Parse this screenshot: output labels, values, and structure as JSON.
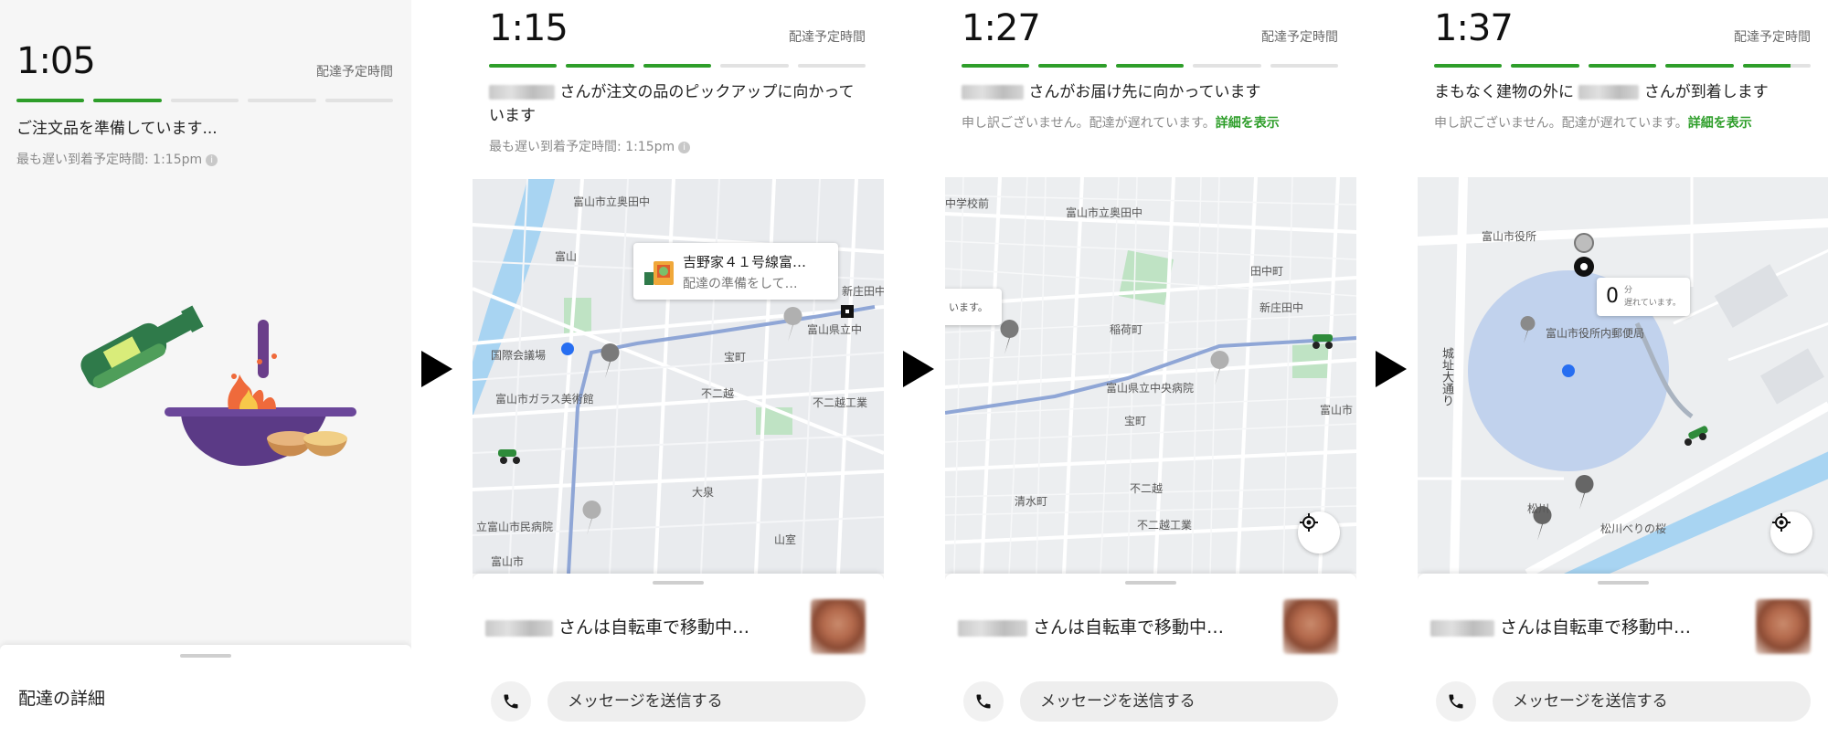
{
  "eta_label": "配達予定時間",
  "panels": [
    {
      "time": "1:05",
      "progress_filled": 2,
      "progress_total": 5,
      "status": "ご注文品を準備しています...",
      "sub": "最も遅い到着予定時間: 1:15pm",
      "sheet_title": "配達の詳細"
    },
    {
      "time": "1:15",
      "progress_filled": 3,
      "progress_total": 5,
      "status": "さんが注文の品のピックアップに向かっています",
      "sub": "最も遅い到着予定時間: 1:15pm",
      "restaurant_name": "吉野家４１号線富…",
      "restaurant_status": "配達の準備をして…",
      "map_labels": [
        "富山市立奥田中",
        "富山",
        "国際会議場",
        "富山市ガラス美術館",
        "宝町",
        "不二越",
        "不二越工業",
        "大泉",
        "山室",
        "立富山市民病院",
        "富山市",
        "新庄田中",
        "富山県立中"
      ],
      "courier_status": "さんは自転車で移動中…",
      "message_placeholder": "メッセージを送信する"
    },
    {
      "time": "1:27",
      "progress_filled": 3,
      "progress_total": 5,
      "status": "さんがお届け先に向かっています",
      "sub": "申し訳ございません。配達が遅れています。",
      "sub_link": "詳細を表示",
      "callout_text": "います。",
      "map_labels": [
        "中学校前",
        "富山市立奥田中",
        "田中町",
        "新庄田中",
        "稲荷町",
        "富山県立中央病院",
        "宝町",
        "清水町",
        "不二越",
        "不二越工業",
        "富山市"
      ],
      "courier_status": "さんは自転車で移動中…",
      "message_placeholder": "メッセージを送信する"
    },
    {
      "time": "1:37",
      "progress_filled": 5,
      "progress_total": 5,
      "status_before": "まもなく建物の外に",
      "status_after": "さんが到着します",
      "sub": "申し訳ございません。配達が遅れています。",
      "sub_link": "詳細を表示",
      "delay_value": "0",
      "delay_unit": "分",
      "delay_text": "遅れています。",
      "map_labels": [
        "富山市役所",
        "富山市役所内郵便局",
        "城址大通り",
        "松川",
        "松川べりの桜"
      ],
      "courier_status": "さんは自転車で移動中…",
      "message_placeholder": "メッセージを送信する"
    }
  ],
  "colors": {
    "accent_green": "#2e9e2a",
    "route_blue": "#8fa6d6",
    "river_blue": "#a8d4f2",
    "park_green": "#bfe3c4"
  }
}
